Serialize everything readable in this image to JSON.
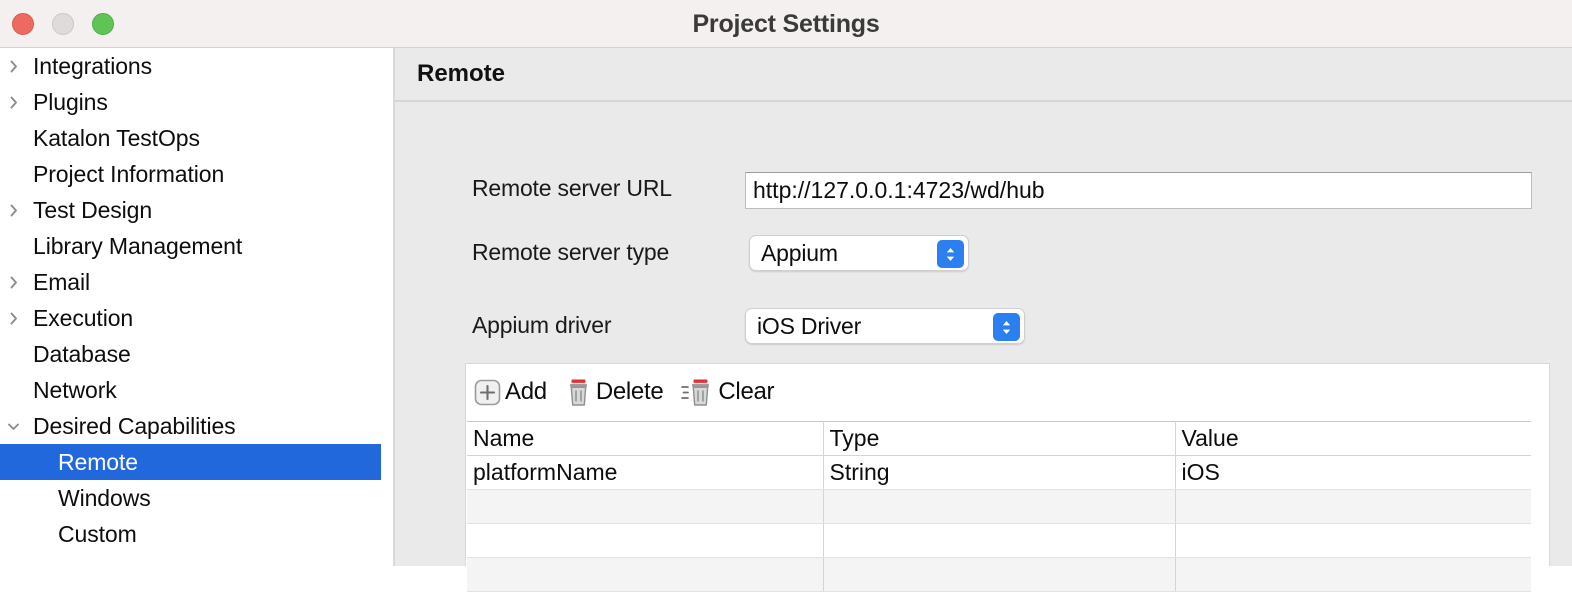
{
  "window": {
    "title": "Project Settings",
    "traffic_lights": [
      "close-button",
      "minimize-button",
      "maximize-button"
    ]
  },
  "sidebar": {
    "items": [
      {
        "label": "Integrations",
        "level": 1,
        "twisty": "chevron-right",
        "selected": false
      },
      {
        "label": "Plugins",
        "level": 1,
        "twisty": "chevron-right",
        "selected": false
      },
      {
        "label": "Katalon TestOps",
        "level": 1,
        "twisty": "none",
        "selected": false
      },
      {
        "label": "Project Information",
        "level": 1,
        "twisty": "none",
        "selected": false
      },
      {
        "label": "Test Design",
        "level": 1,
        "twisty": "chevron-right",
        "selected": false
      },
      {
        "label": "Library Management",
        "level": 1,
        "twisty": "none",
        "selected": false
      },
      {
        "label": "Email",
        "level": 1,
        "twisty": "chevron-right",
        "selected": false
      },
      {
        "label": "Execution",
        "level": 1,
        "twisty": "chevron-right",
        "selected": false
      },
      {
        "label": "Database",
        "level": 1,
        "twisty": "none",
        "selected": false
      },
      {
        "label": "Network",
        "level": 1,
        "twisty": "none",
        "selected": false
      },
      {
        "label": "Desired Capabilities",
        "level": 1,
        "twisty": "chevron-down",
        "selected": false
      },
      {
        "label": "Remote",
        "level": 2,
        "twisty": "none",
        "selected": true
      },
      {
        "label": "Windows",
        "level": 2,
        "twisty": "none",
        "selected": false
      },
      {
        "label": "Custom",
        "level": 2,
        "twisty": "none",
        "selected": false
      }
    ],
    "selected_color": "#2268dd"
  },
  "main": {
    "section_title": "Remote",
    "fields": {
      "url_label": "Remote server URL",
      "url_value": "http://127.0.0.1:4723/wd/hub",
      "url_placeholder": "",
      "type_label": "Remote server type",
      "type_value": "Appium",
      "driver_label": "Appium driver",
      "driver_value": "iOS Driver"
    },
    "toolbar": {
      "add_label": "Add",
      "delete_label": "Delete",
      "clear_label": "Clear"
    },
    "table": {
      "columns": [
        "Name",
        "Type",
        "Value"
      ],
      "rows": [
        {
          "name": "platformName",
          "type": "String",
          "value": "iOS"
        },
        {
          "name": "",
          "type": "",
          "value": ""
        },
        {
          "name": "",
          "type": "",
          "value": ""
        },
        {
          "name": "",
          "type": "",
          "value": ""
        }
      ]
    }
  },
  "colors": {
    "accent": "#2268dd",
    "stepper": "#2b7ff0",
    "panel_bg": "#eaeaea",
    "titlebar_bg": "#f3f0ef",
    "trash_lid": "#e03131"
  }
}
